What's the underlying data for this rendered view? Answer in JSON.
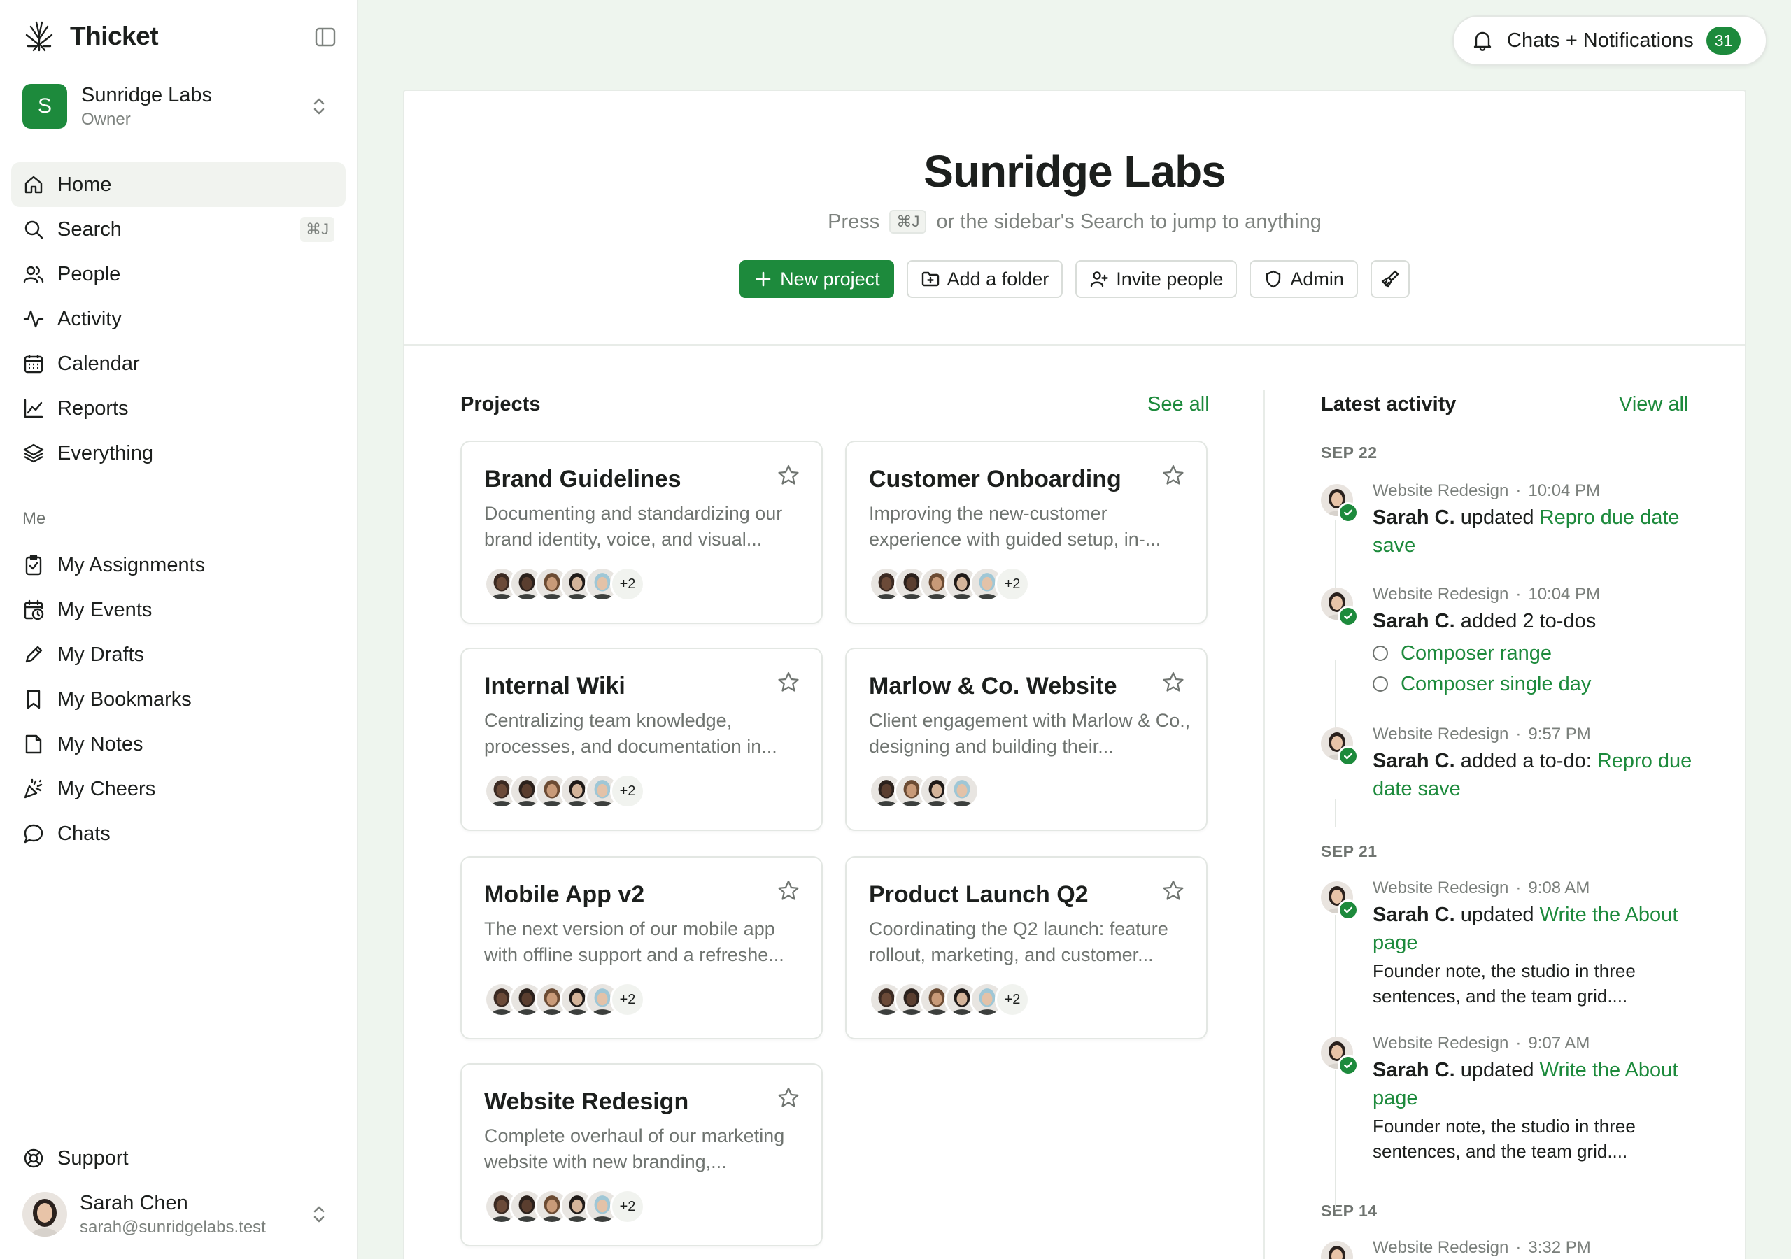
{
  "app": {
    "name": "Thicket"
  },
  "org": {
    "initial": "S",
    "name": "Sunridge Labs",
    "role": "Owner"
  },
  "nav": {
    "main": [
      {
        "label": "Home",
        "icon": "home-icon",
        "active": true
      },
      {
        "label": "Search",
        "icon": "search-icon",
        "shortcut": "⌘J"
      },
      {
        "label": "People",
        "icon": "people-icon"
      },
      {
        "label": "Activity",
        "icon": "activity-icon"
      },
      {
        "label": "Calendar",
        "icon": "calendar-icon"
      },
      {
        "label": "Reports",
        "icon": "reports-icon"
      },
      {
        "label": "Everything",
        "icon": "layers-icon"
      }
    ],
    "me_label": "Me",
    "me": [
      {
        "label": "My Assignments",
        "icon": "clipboard-check-icon"
      },
      {
        "label": "My Events",
        "icon": "calendar-clock-icon"
      },
      {
        "label": "My Drafts",
        "icon": "pencil-icon"
      },
      {
        "label": "My Bookmarks",
        "icon": "bookmark-icon"
      },
      {
        "label": "My Notes",
        "icon": "note-icon"
      },
      {
        "label": "My Cheers",
        "icon": "party-icon"
      },
      {
        "label": "Chats",
        "icon": "chat-bubble-icon"
      }
    ],
    "support": "Support"
  },
  "user": {
    "name": "Sarah Chen",
    "email": "sarah@sunridgelabs.test"
  },
  "notifications": {
    "label": "Chats + Notifications",
    "count": "31"
  },
  "hero": {
    "title": "Sunridge Labs",
    "sub_before": "Press",
    "sub_key": "⌘J",
    "sub_after": "or the sidebar's Search to jump to anything",
    "actions": {
      "new_project": "New project",
      "add_folder": "Add a folder",
      "invite": "Invite people",
      "admin": "Admin"
    }
  },
  "projects": {
    "title": "Projects",
    "see_all": "See all",
    "items": [
      {
        "title": "Brand Guidelines",
        "desc": "Documenting and standardizing our brand identity, voice, and visual...",
        "more": "+2"
      },
      {
        "title": "Customer Onboarding",
        "desc": "Improving the new-customer experience with guided setup, in-...",
        "more": "+2"
      },
      {
        "title": "Internal Wiki",
        "desc": "Centralizing team knowledge, processes, and documentation in...",
        "more": "+2"
      },
      {
        "title": "Marlow & Co. Website",
        "desc": "Client engagement with Marlow & Co., designing and building their...",
        "more": ""
      },
      {
        "title": "Mobile App v2",
        "desc": "The next version of our mobile app with offline support and a refreshe...",
        "more": "+2"
      },
      {
        "title": "Product Launch Q2",
        "desc": "Coordinating the Q2 launch: feature rollout, marketing, and customer...",
        "more": "+2"
      },
      {
        "title": "Website Redesign",
        "desc": "Complete overhaul of our marketing website with new branding,...",
        "more": "+2"
      }
    ]
  },
  "activity": {
    "title": "Latest activity",
    "view_all": "View all",
    "dates": [
      "SEP 22",
      "SEP 21",
      "SEP 14"
    ],
    "items": [
      {
        "project": "Website Redesign",
        "time": "10:04 PM",
        "who": "Sarah C.",
        "verb": "updated",
        "link": "Repro due date save"
      },
      {
        "project": "Website Redesign",
        "time": "10:04 PM",
        "who": "Sarah C.",
        "verb": "added 2 to-dos",
        "todos": [
          "Composer range",
          "Composer single day"
        ]
      },
      {
        "project": "Website Redesign",
        "time": "9:57 PM",
        "who": "Sarah C.",
        "verb": "added a to-do:",
        "link": "Repro due date save"
      },
      {
        "project": "Website Redesign",
        "time": "9:08 AM",
        "who": "Sarah C.",
        "verb": "updated",
        "link": "Write the About page",
        "note": "Founder note, the studio in three sentences, and the team grid...."
      },
      {
        "project": "Website Redesign",
        "time": "9:07 AM",
        "who": "Sarah C.",
        "verb": "updated",
        "link": "Write the About page",
        "note": "Founder note, the studio in three sentences, and the team grid...."
      },
      {
        "project": "Website Redesign",
        "time": "3:32 PM"
      }
    ]
  },
  "colors": {
    "accent": "#1d8a3c",
    "background": "#eef5ee"
  }
}
